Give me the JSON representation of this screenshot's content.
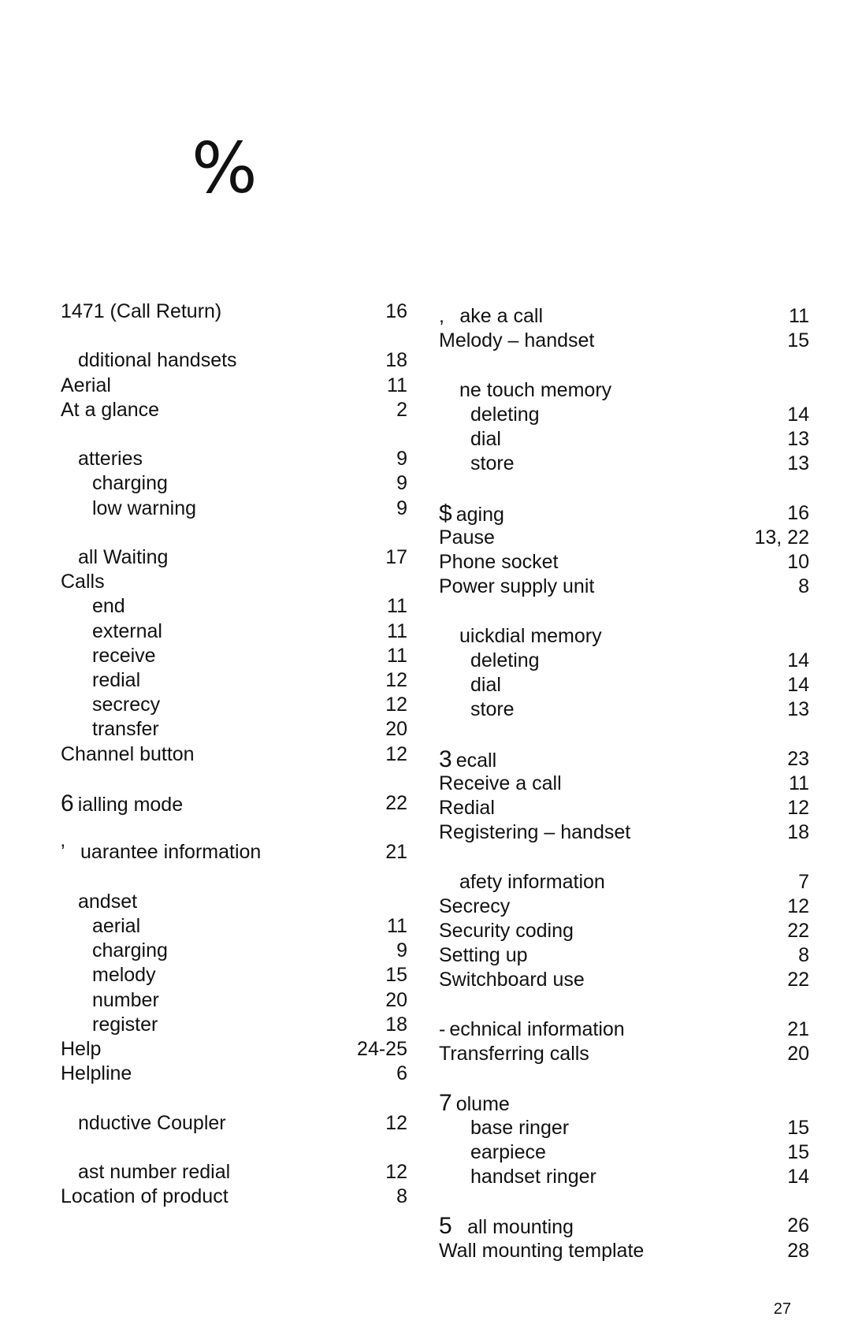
{
  "heading": {
    "letter_glyph": "%"
  },
  "left_column": [
    {
      "prefix": "",
      "term": "1471 (Call Return)",
      "page": "16",
      "level": 0,
      "gap_before": false
    },
    {
      "prefix": "",
      "term": "dditional handsets",
      "page": "18",
      "level": 1,
      "gap_before": true
    },
    {
      "prefix": "",
      "term": "Aerial",
      "page": "11",
      "level": 0,
      "gap_before": false
    },
    {
      "prefix": "",
      "term": "At a glance",
      "page": "2",
      "level": 0,
      "gap_before": false
    },
    {
      "prefix": "",
      "term": "atteries",
      "page": "9",
      "level": 1,
      "gap_before": true
    },
    {
      "prefix": "",
      "term": "charging",
      "page": "9",
      "level": 2,
      "gap_before": false
    },
    {
      "prefix": "",
      "term": "low warning",
      "page": "9",
      "level": 2,
      "gap_before": false
    },
    {
      "prefix": "",
      "term": "all Waiting",
      "page": "17",
      "level": 1,
      "gap_before": true
    },
    {
      "prefix": "",
      "term": "Calls",
      "page": "",
      "level": 0,
      "gap_before": false
    },
    {
      "prefix": "",
      "term": "end",
      "page": "11",
      "level": 2,
      "gap_before": false
    },
    {
      "prefix": "",
      "term": "external",
      "page": "11",
      "level": 2,
      "gap_before": false
    },
    {
      "prefix": "",
      "term": "receive",
      "page": "11",
      "level": 2,
      "gap_before": false
    },
    {
      "prefix": "",
      "term": "redial",
      "page": "12",
      "level": 2,
      "gap_before": false
    },
    {
      "prefix": "",
      "term": "secrecy",
      "page": "12",
      "level": 2,
      "gap_before": false
    },
    {
      "prefix": "",
      "term": "transfer",
      "page": "20",
      "level": 2,
      "gap_before": false
    },
    {
      "prefix": "",
      "term": "Channel button",
      "page": "12",
      "level": 0,
      "gap_before": false
    },
    {
      "prefix": "6",
      "term": "ialling mode",
      "page": "22",
      "level": 0,
      "gap_before": true
    },
    {
      "prefix": "’",
      "term": "uarantee information",
      "page": "21",
      "level": 0,
      "gap_before": true
    },
    {
      "prefix": "",
      "term": "andset",
      "page": "",
      "level": 1,
      "gap_before": true
    },
    {
      "prefix": "",
      "term": "aerial",
      "page": "11",
      "level": 2,
      "gap_before": false
    },
    {
      "prefix": "",
      "term": "charging",
      "page": "9",
      "level": 2,
      "gap_before": false
    },
    {
      "prefix": "",
      "term": "melody",
      "page": "15",
      "level": 2,
      "gap_before": false
    },
    {
      "prefix": "",
      "term": "number",
      "page": "20",
      "level": 2,
      "gap_before": false
    },
    {
      "prefix": "",
      "term": "register",
      "page": "18",
      "level": 2,
      "gap_before": false
    },
    {
      "prefix": "",
      "term": "Help",
      "page": "24-25",
      "level": 0,
      "gap_before": false
    },
    {
      "prefix": "",
      "term": "Helpline",
      "page": "6",
      "level": 0,
      "gap_before": false
    },
    {
      "prefix": "",
      "term": "nductive Coupler",
      "page": "12",
      "level": 1,
      "gap_before": true
    },
    {
      "prefix": "",
      "term": "ast number redial",
      "page": "12",
      "level": 1,
      "gap_before": true
    },
    {
      "prefix": "",
      "term": "Location of product",
      "page": "8",
      "level": 0,
      "gap_before": false
    }
  ],
  "right_column": [
    {
      "prefix": ",",
      "term": "ake a call",
      "page": "11",
      "level": 0,
      "gap_before": false
    },
    {
      "prefix": "",
      "term": "Melody – handset",
      "page": "15",
      "level": 0,
      "gap_before": false
    },
    {
      "prefix": "",
      "term": "ne touch memory",
      "page": "",
      "level": 1,
      "gap_before": true
    },
    {
      "prefix": "",
      "term": "deleting",
      "page": "14",
      "level": 2,
      "gap_before": false
    },
    {
      "prefix": "",
      "term": "dial",
      "page": "13",
      "level": 2,
      "gap_before": false
    },
    {
      "prefix": "",
      "term": "store",
      "page": "13",
      "level": 2,
      "gap_before": false
    },
    {
      "prefix": "$",
      "term": "aging",
      "page": "16",
      "level": 0,
      "gap_before": true
    },
    {
      "prefix": "",
      "term": "Pause",
      "page": "13, 22",
      "level": 0,
      "gap_before": false
    },
    {
      "prefix": "",
      "term": "Phone socket",
      "page": "10",
      "level": 0,
      "gap_before": false
    },
    {
      "prefix": "",
      "term": "Power supply unit",
      "page": "8",
      "level": 0,
      "gap_before": false
    },
    {
      "prefix": "",
      "term": "uickdial memory",
      "page": "",
      "level": 1,
      "gap_before": true
    },
    {
      "prefix": "",
      "term": "deleting",
      "page": "14",
      "level": 2,
      "gap_before": false
    },
    {
      "prefix": "",
      "term": "dial",
      "page": "14",
      "level": 2,
      "gap_before": false
    },
    {
      "prefix": "",
      "term": "store",
      "page": "13",
      "level": 2,
      "gap_before": false
    },
    {
      "prefix": "3",
      "term": "ecall",
      "page": "23",
      "level": 0,
      "gap_before": true
    },
    {
      "prefix": "",
      "term": "Receive a call",
      "page": "11",
      "level": 0,
      "gap_before": false
    },
    {
      "prefix": "",
      "term": "Redial",
      "page": "12",
      "level": 0,
      "gap_before": false
    },
    {
      "prefix": "",
      "term": "Registering – handset",
      "page": "18",
      "level": 0,
      "gap_before": false
    },
    {
      "prefix": "",
      "term": "afety information",
      "page": "7",
      "level": 1,
      "gap_before": true
    },
    {
      "prefix": "",
      "term": "Secrecy",
      "page": "12",
      "level": 0,
      "gap_before": false
    },
    {
      "prefix": "",
      "term": "Security coding",
      "page": "22",
      "level": 0,
      "gap_before": false
    },
    {
      "prefix": "",
      "term": "Setting up",
      "page": "8",
      "level": 0,
      "gap_before": false
    },
    {
      "prefix": "",
      "term": "Switchboard use",
      "page": "22",
      "level": 0,
      "gap_before": false
    },
    {
      "prefix": "-",
      "term": "echnical information",
      "page": "21",
      "level": 0,
      "gap_before": true
    },
    {
      "prefix": "",
      "term": "Transferring calls",
      "page": "20",
      "level": 0,
      "gap_before": false
    },
    {
      "prefix": "7",
      "term": "olume",
      "page": "",
      "level": 0,
      "gap_before": true
    },
    {
      "prefix": "",
      "term": "base ringer",
      "page": "15",
      "level": 2,
      "gap_before": false
    },
    {
      "prefix": "",
      "term": "earpiece",
      "page": "15",
      "level": 2,
      "gap_before": false
    },
    {
      "prefix": "",
      "term": "handset ringer",
      "page": "14",
      "level": 2,
      "gap_before": false
    },
    {
      "prefix": "5",
      "term": "all mounting",
      "page": "26",
      "level": 0,
      "gap_before": true
    },
    {
      "prefix": "",
      "term": "Wall mounting template",
      "page": "28",
      "level": 0,
      "gap_before": false
    }
  ],
  "footer": {
    "page_number": "27"
  }
}
